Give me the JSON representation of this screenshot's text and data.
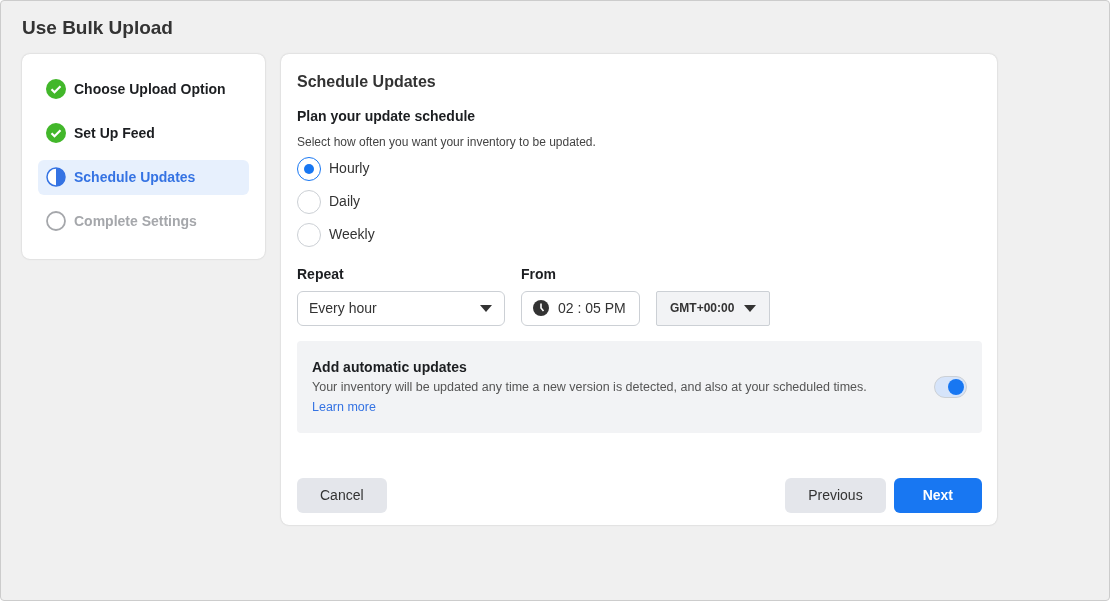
{
  "window": {
    "title": "Use Bulk Upload"
  },
  "steps": [
    {
      "label": "Choose Upload Option",
      "kind": "done",
      "selected": false
    },
    {
      "label": "Set Up Feed",
      "kind": "done",
      "selected": false
    },
    {
      "label": "Schedule Updates",
      "kind": "current",
      "selected": true
    },
    {
      "label": "Complete Settings",
      "kind": "pending",
      "selected": false
    }
  ],
  "panel": {
    "title": "Schedule Updates",
    "heading": "Plan your update schedule",
    "hint": "Select how often you want your inventory to be updated.",
    "frequency": [
      {
        "label": "Hourly",
        "selected": true
      },
      {
        "label": "Daily",
        "selected": false
      },
      {
        "label": "Weekly",
        "selected": false
      }
    ],
    "repeat": {
      "label": "Repeat",
      "value": "Every hour"
    },
    "from": {
      "label": "From",
      "time": "02 : 05 PM",
      "timezone": "GMT+00:00"
    },
    "auto_updates": {
      "title": "Add automatic updates",
      "text": "Your inventory will be updated any time a new version is detected, and also at your scheduled times.",
      "link": "Learn more",
      "on": true
    }
  },
  "buttons": {
    "cancel": "Cancel",
    "previous": "Previous",
    "next": "Next"
  }
}
